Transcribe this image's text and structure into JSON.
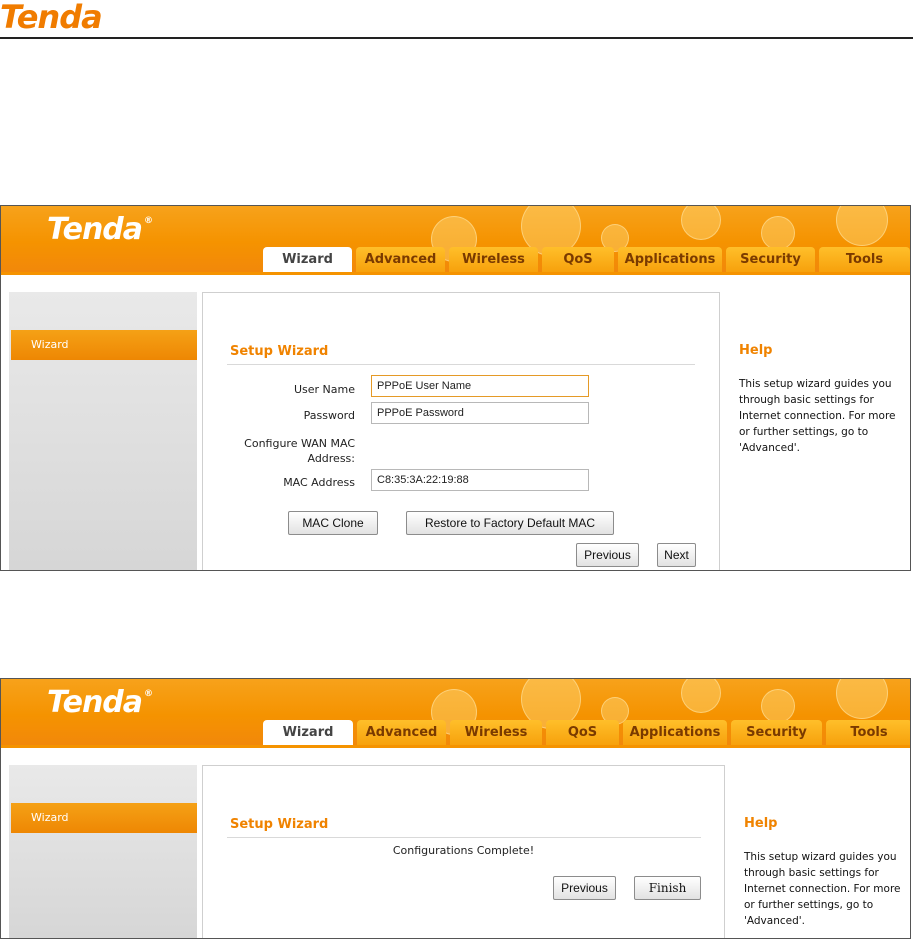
{
  "document": {
    "logo": "Tenda"
  },
  "panels": [
    {
      "logo": "Tenda",
      "logo_mark": "®",
      "tabs": [
        "Wizard",
        "Advanced",
        "Wireless",
        "QoS",
        "Applications",
        "Security",
        "Tools"
      ],
      "active_tab": "Wizard",
      "sidebar": {
        "items": [
          "Wizard"
        ]
      },
      "section_title": "Setup Wizard",
      "form": {
        "user_name_label": "User Name",
        "user_name_value": "PPPoE User Name",
        "password_label": "Password",
        "password_value": "PPPoE Password",
        "wan_mac_label_line1": "Configure WAN MAC",
        "wan_mac_label_line2": "Address:",
        "mac_address_label": "MAC Address",
        "mac_address_value": "C8:35:3A:22:19:88"
      },
      "buttons": {
        "mac_clone": "MAC Clone",
        "restore_mac": "Restore to Factory Default MAC",
        "previous": "Previous",
        "next": "Next"
      },
      "help": {
        "title": "Help",
        "text": "This setup wizard guides you through basic settings for Internet connection. For more or further settings, go to 'Advanced'."
      }
    },
    {
      "logo": "Tenda",
      "logo_mark": "®",
      "tabs": [
        "Wizard",
        "Advanced",
        "Wireless",
        "QoS",
        "Applications",
        "Security",
        "Tools"
      ],
      "active_tab": "Wizard",
      "sidebar": {
        "items": [
          "Wizard"
        ]
      },
      "section_title": "Setup Wizard",
      "message": "Configurations Complete!",
      "buttons": {
        "previous": "Previous",
        "finish": "Finish"
      },
      "help": {
        "title": "Help",
        "text": "This setup wizard guides you through basic settings for Internet connection. For more or further settings, go to 'Advanced'."
      }
    }
  ],
  "colors": {
    "brand_orange": "#f59300",
    "title_orange": "#f08300",
    "tab_gold": "#ffbf2a"
  }
}
